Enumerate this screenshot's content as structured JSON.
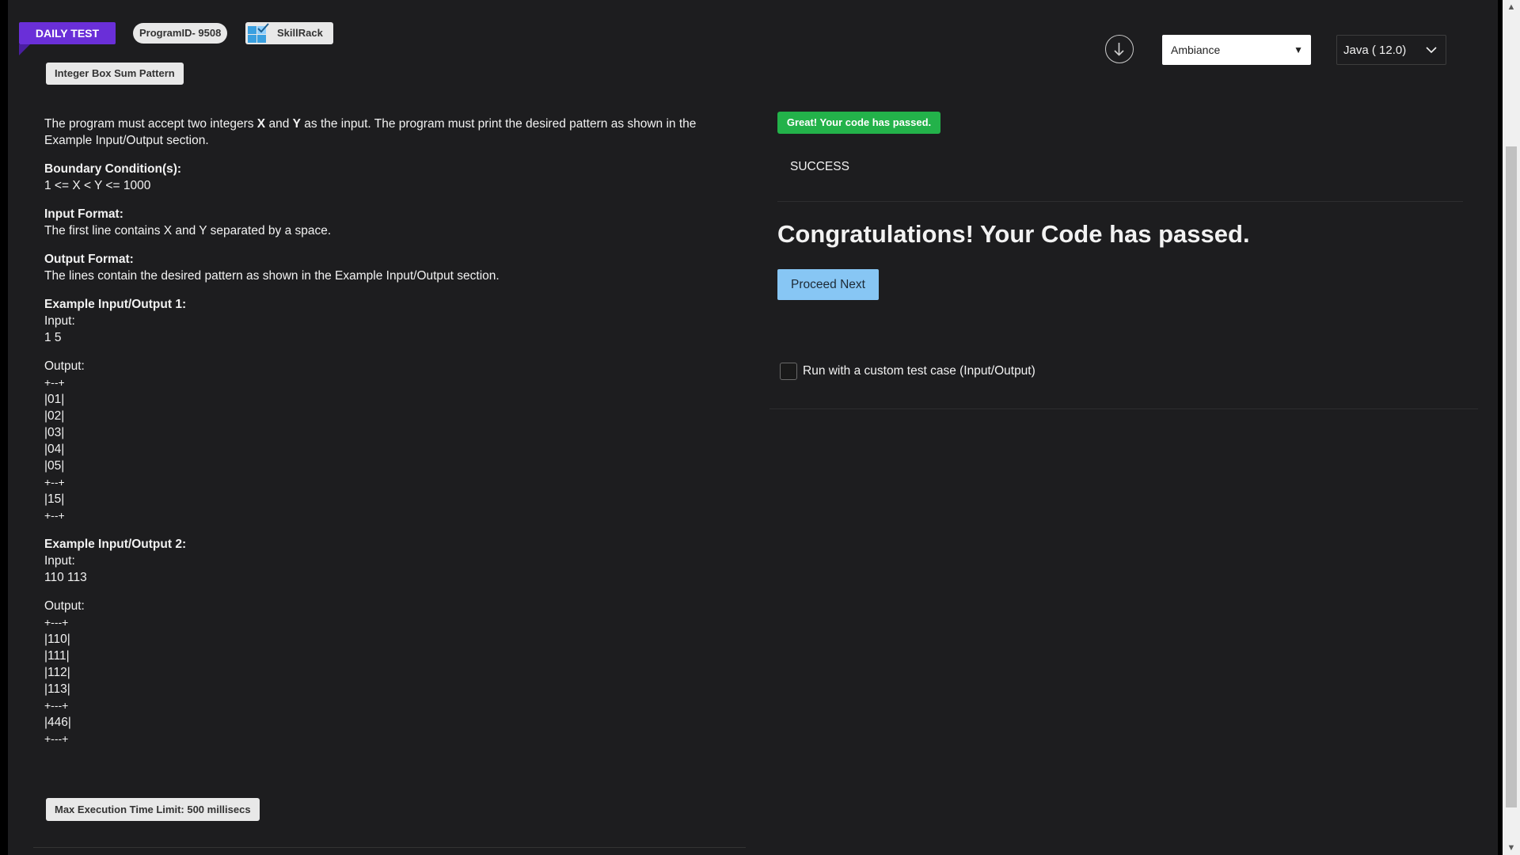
{
  "header": {
    "daily_test_label": "DAILY TEST",
    "program_id_label": "ProgramID- 9508",
    "brand_label": "SkillRack",
    "problem_title": "Integer Box Sum Pattern"
  },
  "problem": {
    "intro": [
      {
        "text": "The program must accept two integers ",
        "bold": false
      },
      {
        "text": "X",
        "bold": true
      },
      {
        "text": " and ",
        "bold": false
      },
      {
        "text": "Y",
        "bold": true
      },
      {
        "text": " as the input. The program must print the desired pattern as shown in the Example Input/Output section.",
        "bold": false
      }
    ],
    "boundary_heading": "Boundary Condition(s):",
    "boundary_text": "1 <= X < Y <= 1000",
    "input_format_heading": "Input Format:",
    "input_format_text": "The first line contains X and Y separated by a space.",
    "output_format_heading": "Output Format:",
    "output_format_text": "The lines contain the desired pattern as shown in the Example Input/Output section.",
    "example1": {
      "heading": "Example Input/Output 1:",
      "input_label": "Input:",
      "input_value": "1 5",
      "output_label": "Output:",
      "output_lines": [
        "+--+",
        "|01|",
        "|02|",
        "|03|",
        "|04|",
        "|05|",
        "+--+",
        "|15|",
        "+--+"
      ]
    },
    "example2": {
      "heading": "Example Input/Output 2:",
      "input_label": "Input:",
      "input_value": "110 113",
      "output_label": "Output:",
      "output_lines": [
        "+---+",
        "|110|",
        "|111|",
        "|112|",
        "|113|",
        "+---+",
        "|446|",
        "+---+"
      ]
    },
    "time_limit_label": "Max Execution Time Limit: 500 millisecs"
  },
  "toolbar": {
    "download_icon": "download-icon",
    "theme_value": "Ambiance",
    "language_value": "Java ( 12.0)"
  },
  "result": {
    "badge_text": "Great! Your code has passed.",
    "status_text": "SUCCESS",
    "congrats_text": "Congratulations! Your Code has passed.",
    "proceed_label": "Proceed Next",
    "custom_test_label": "Run with a custom test case (Input/Output)",
    "custom_test_checked": false
  },
  "colors": {
    "page_bg": "#1d1d1f",
    "ribbon": "#6a2fd8",
    "success_green": "#23b24a",
    "proceed_blue": "#87c6f4"
  }
}
